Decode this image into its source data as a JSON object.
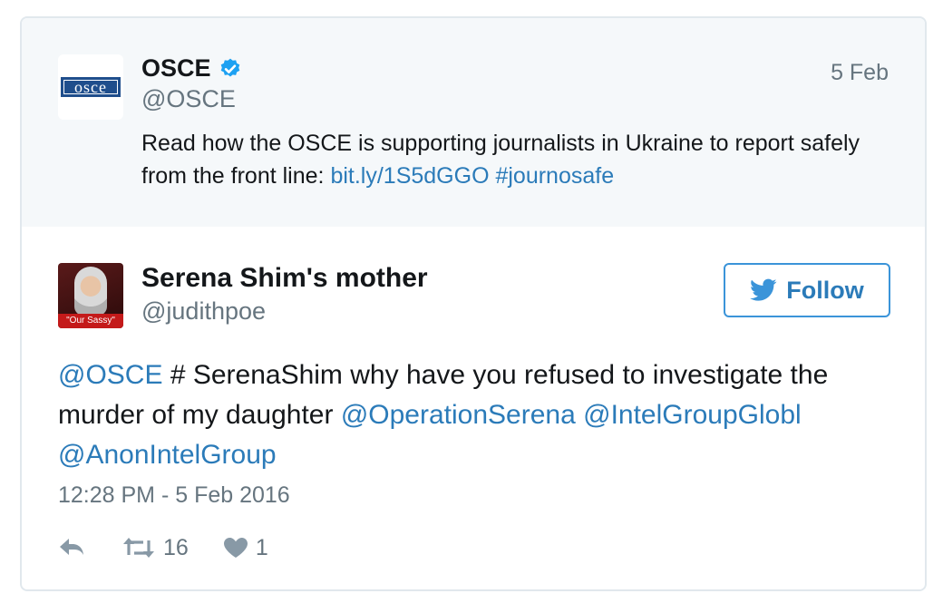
{
  "parent_tweet": {
    "logo_text": "osce",
    "name": "OSCE",
    "handle": "@OSCE",
    "date": "5 Feb",
    "text_plain": "Read how the OSCE is supporting journalists in Ukraine to report safely from the front line: ",
    "link": "bit.ly/1S5dGGO",
    "hashtag": "#journosafe"
  },
  "tweet": {
    "name": "Serena Shim's mother",
    "handle": "@judithpoe",
    "avatar_caption": "\"Our Sassy\"",
    "follow_label": "Follow",
    "mention_1": "@OSCE",
    "text_1": " # SerenaShim why have you refused to investigate the murder of my daughter ",
    "mention_2": "@OperationSerena",
    "mention_3": "@IntelGroupGlobl",
    "mention_4": "@AnonIntelGroup",
    "timestamp": "12:28 PM - 5 Feb 2016",
    "retweet_count": "16",
    "like_count": "1"
  },
  "colors": {
    "link": "#2b7bb9",
    "verified": "#1da1f2",
    "parent_bg": "#f5f8fa",
    "muted": "#66757f"
  }
}
